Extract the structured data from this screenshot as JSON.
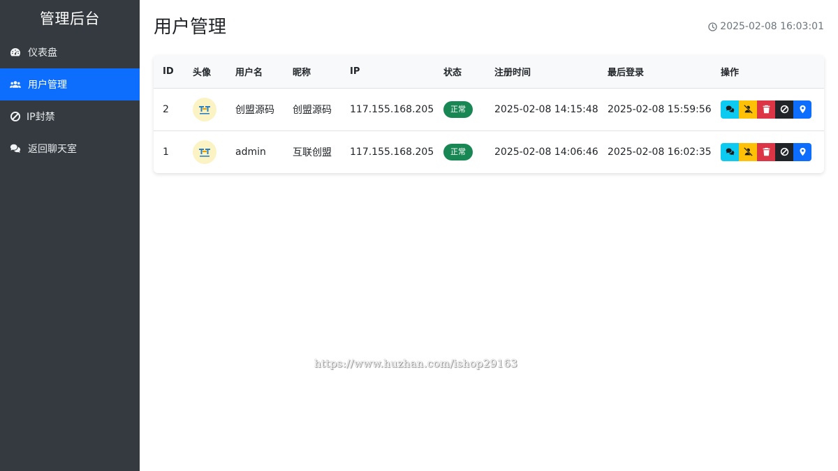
{
  "sidebar": {
    "brand": "管理后台",
    "items": [
      {
        "label": "仪表盘",
        "icon": "dashboard-icon"
      },
      {
        "label": "用户管理",
        "icon": "users-icon",
        "active": true
      },
      {
        "label": "IP封禁",
        "icon": "ban-icon"
      },
      {
        "label": "返回聊天室",
        "icon": "chat-icon"
      }
    ]
  },
  "header": {
    "title": "用户管理",
    "datetime": "2025-02-08 16:03:01"
  },
  "table": {
    "columns": [
      "ID",
      "头像",
      "用户名",
      "昵称",
      "IP",
      "状态",
      "注册时间",
      "最后登录",
      "操作"
    ],
    "rows": [
      {
        "id": "2",
        "username": "创盟源码",
        "nickname": "创盟源码",
        "ip": "117.155.168.205",
        "status": "正常",
        "registered": "2025-02-08 14:15:48",
        "last_login": "2025-02-08 15:59:56"
      },
      {
        "id": "1",
        "username": "admin",
        "nickname": "互联创盟",
        "ip": "117.155.168.205",
        "status": "正常",
        "registered": "2025-02-08 14:06:46",
        "last_login": "2025-02-08 16:02:35"
      }
    ]
  },
  "actions": [
    {
      "name": "chat-button",
      "icon": "comments-icon",
      "color": "#0dcaf0"
    },
    {
      "name": "mute-button",
      "icon": "user-slash-icon",
      "color": "#ffc107"
    },
    {
      "name": "delete-button",
      "icon": "trash-icon",
      "color": "#dc3545"
    },
    {
      "name": "ban-button",
      "icon": "ban-icon",
      "color": "#212529"
    },
    {
      "name": "location-button",
      "icon": "map-marker-icon",
      "color": "#0d6efd"
    }
  ],
  "colors": {
    "sidebar_bg": "#343a40",
    "accent": "#0d6efd",
    "status_ok": "#198754"
  },
  "watermark": "https://www.huzhan.com/ishop29163"
}
